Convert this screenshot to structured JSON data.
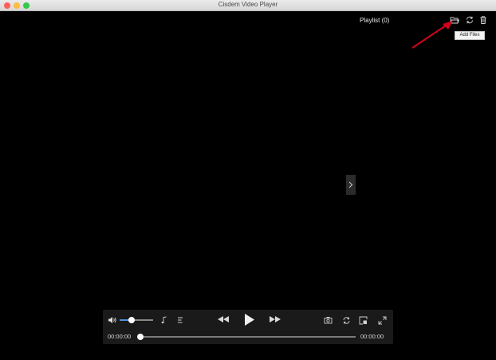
{
  "window": {
    "title": "Cisdem Video Player"
  },
  "playlist": {
    "title": "Playlist (0)",
    "tooltip": "Add Files",
    "icons": [
      "folder-open-icon",
      "refresh-icon",
      "trash-icon"
    ]
  },
  "player": {
    "current_time": "00:00:00",
    "duration": "00:00:00",
    "volume_fraction": 0.35,
    "progress_fraction": 0
  },
  "colors": {
    "annotation_arrow": "#d0021b",
    "volume_accent": "#4a90e2"
  }
}
